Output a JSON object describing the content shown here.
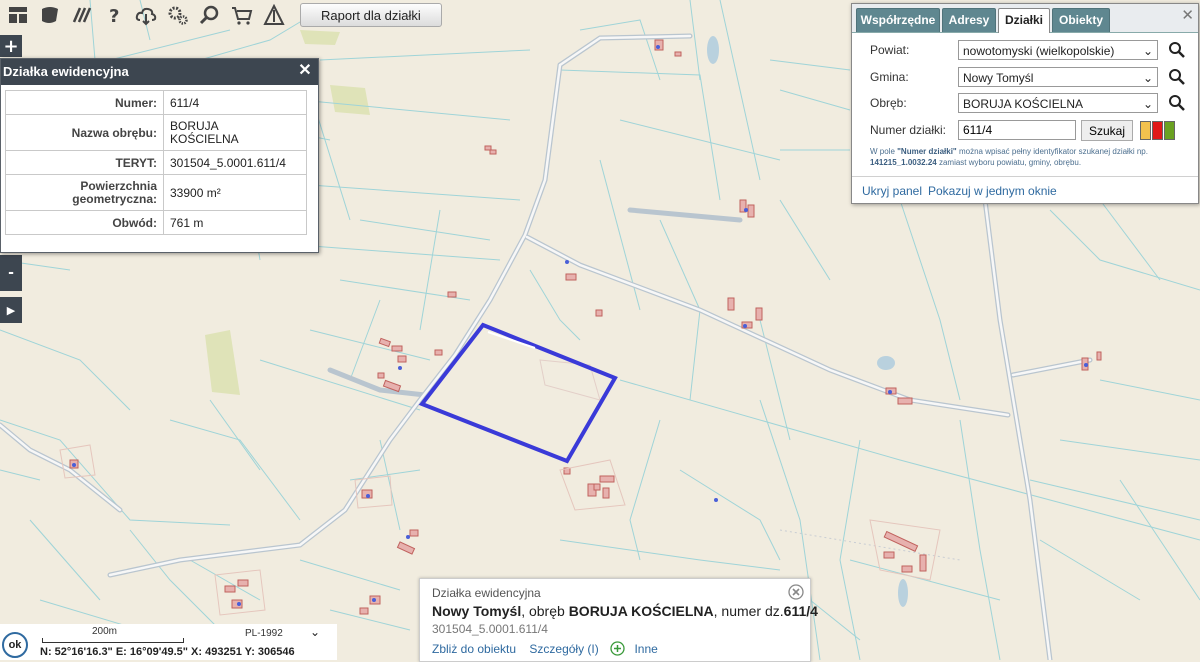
{
  "toolbar": {
    "report_button": "Raport dla działki",
    "icons": [
      "layers-icon",
      "map-shapes-icon",
      "hatch-icon",
      "help-icon",
      "cloud-download-icon",
      "settings-icon",
      "zoom-search-icon",
      "cart-icon",
      "triangle-measure-icon"
    ]
  },
  "map_controls": {
    "zoom_in": "+",
    "zoom_out": "-",
    "expand": "▶"
  },
  "parcel_info": {
    "title": "Działka ewidencyjna",
    "rows": [
      {
        "label": "Numer:",
        "value": "611/4"
      },
      {
        "label": "Nazwa obrębu:",
        "value": "BORUJA KOŚCIELNA"
      },
      {
        "label": "TERYT:",
        "value": "301504_5.0001.611/4"
      },
      {
        "label": "Powierzchnia geometryczna:",
        "value": "33900 m²"
      },
      {
        "label": "Obwód:",
        "value": "761 m"
      }
    ]
  },
  "search_panel": {
    "tabs": [
      {
        "label": "Współrzędne",
        "active": false
      },
      {
        "label": "Adresy",
        "active": false
      },
      {
        "label": "Działki",
        "active": true
      },
      {
        "label": "Obiekty",
        "active": false
      }
    ],
    "powiat_label": "Powiat:",
    "powiat_value": "nowotomyski (wielkopolskie)",
    "gmina_label": "Gmina:",
    "gmina_value": "Nowy Tomyśl",
    "obreb_label": "Obręb:",
    "obreb_value": "BORUJA KOŚCIELNA",
    "numer_label": "Numer działki:",
    "numer_value": "611/4",
    "search_button": "Szukaj",
    "hint_prefix": "W pole ",
    "hint_field": "\"Numer działki\"",
    "hint_mid": " można wpisać pełny identyfikator szukanej działki np. ",
    "hint_example": "141215_1.0032.24",
    "hint_suffix": " zamiast wyboru powiatu, gminy, obrębu.",
    "link_hide": "Ukryj panel",
    "link_single": "Pokazuj w jednym oknie",
    "swatch_colors": [
      "#f2c14e",
      "#e01818",
      "#6aa121"
    ]
  },
  "popup": {
    "heading": "Działka ewidencyjna",
    "gmina": "Nowy Tomyśl",
    "obreb_prefix": ", obręb ",
    "obreb": "BORUJA KOŚCIELNA",
    "numer_prefix": ", numer dz.",
    "numer": "611/4",
    "teryt": "301504_5.0001.611/4",
    "link_zoom": "Zbliż do obiektu",
    "link_details": "Szczegóły (I)",
    "link_other": "Inne"
  },
  "status_bar": {
    "ok": "ok",
    "scale": "200m",
    "crs": "PL-1992",
    "coords": "N: 52°16'16.3\"  E: 16°09'49.5\"  X: 493251    Y: 306546"
  },
  "map_colors": {
    "background": "#f1ecdf",
    "parcel_lines": "#8fd0d6",
    "roads": "#b5c0cc",
    "selected_parcel": "#3a3ad8",
    "buildings": "#e4a4a4",
    "meadow": "#dfe3b8",
    "water": "#b9d1de"
  }
}
